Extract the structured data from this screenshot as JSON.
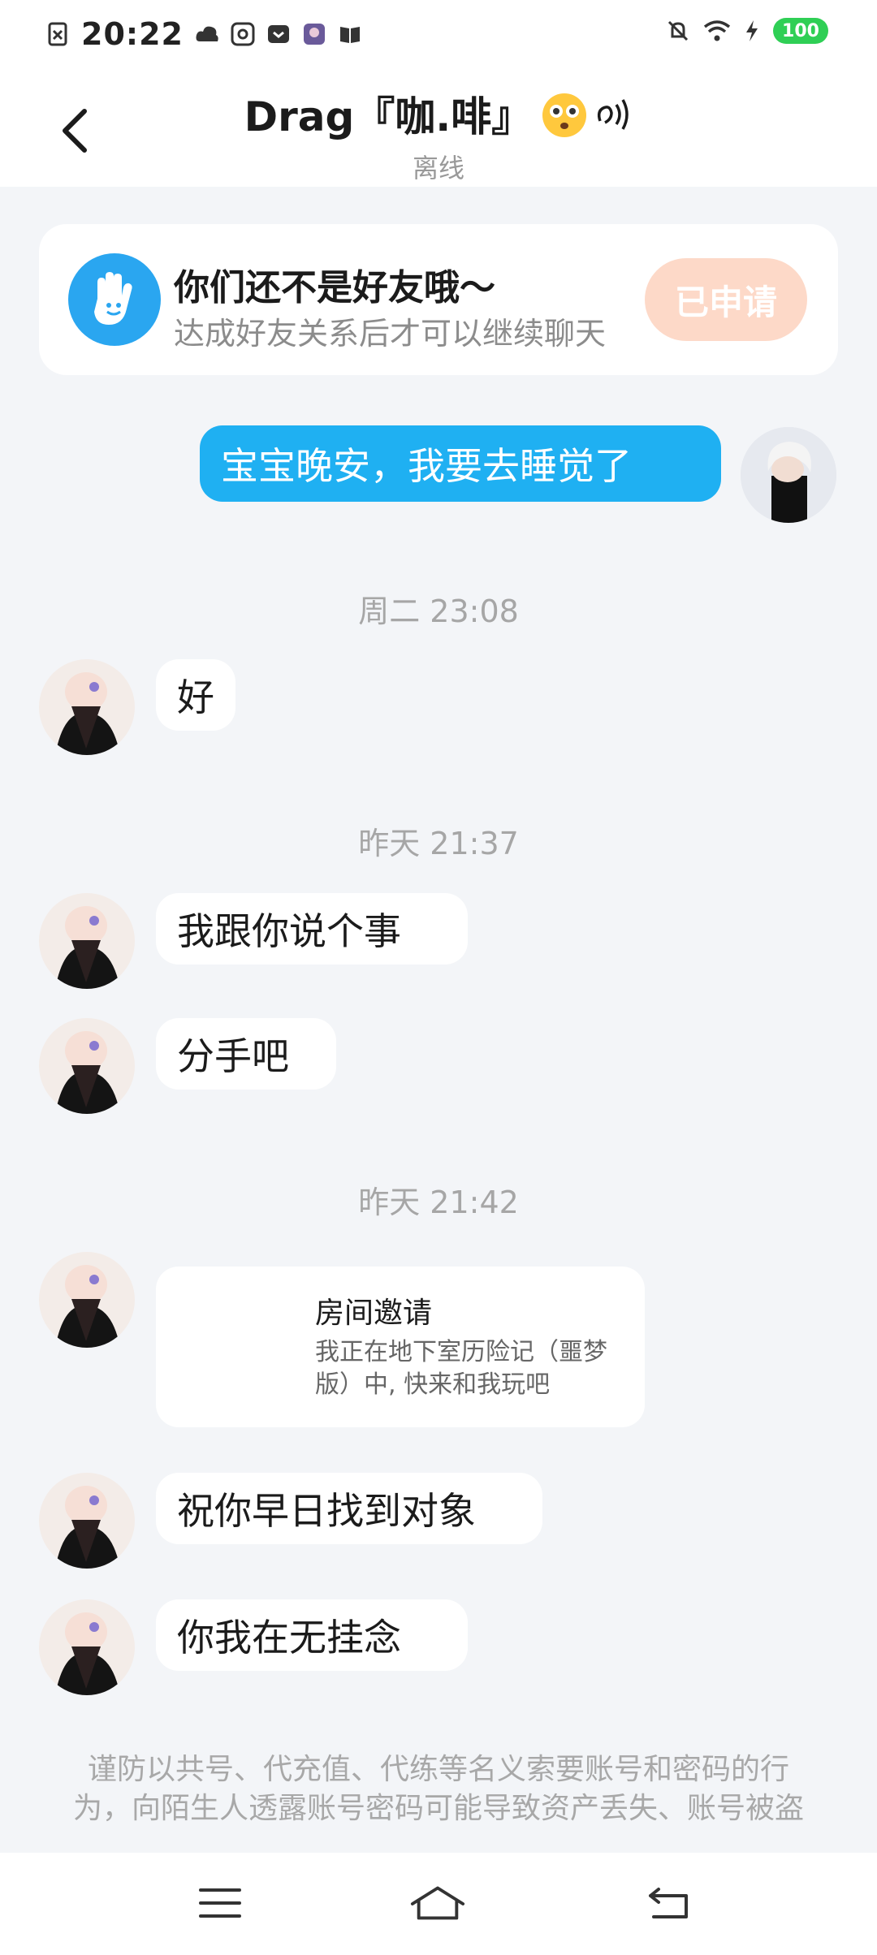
{
  "status_bar": {
    "time": "20:22",
    "battery": "100",
    "icons": [
      "sim-off-icon",
      "cloud-icon",
      "at-icon",
      "pocket-icon",
      "app-avatar-icon",
      "book-icon",
      "mute-bell-icon",
      "wifi-icon",
      "charging-icon"
    ]
  },
  "header": {
    "title": "Drag『咖.啡』",
    "status": "离线"
  },
  "friend_card": {
    "title": "你们还不是好友哦～",
    "description": "达成好友关系后才可以继续聊天",
    "button_label": "已申请"
  },
  "messages": {
    "m1": "宝宝晚安，我要去睡觉了",
    "ts1": "周二 23:08",
    "m2": "好",
    "ts2": "昨天 21:37",
    "m3": "我跟你说个事",
    "m4": "分手吧",
    "ts3": "昨天 21:42",
    "room_title": "房间邀请",
    "room_desc": "我正在地下室历险记（噩梦版）中, 快来和我玩吧",
    "m5": "祝你早日找到对象",
    "m6": "你我在无挂念"
  },
  "warning": "谨防以共号、代充值、代练等名义索要账号和密码的行为，向陌生人透露账号密码可能导致资产丢失、账号被盗",
  "colors": {
    "accent": "#1fb0f2",
    "applied_button": "#fdd9c8",
    "background": "#f3f5f8",
    "battery": "#2fcf55"
  }
}
